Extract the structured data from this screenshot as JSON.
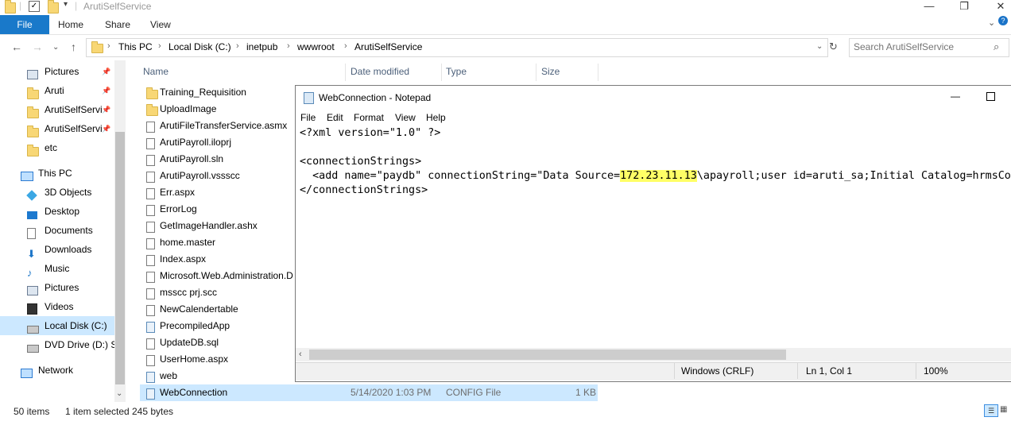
{
  "window": {
    "title": "ArutiSelfService",
    "minimize_glyph": "—",
    "restore_glyph": "❐",
    "close_glyph": "✕"
  },
  "ribbon": {
    "tabs": [
      "File",
      "Home",
      "Share",
      "View"
    ]
  },
  "address": {
    "crumbs": [
      "This PC",
      "Local Disk (C:)",
      "inetpub",
      "wwwroot",
      "ArutiSelfService"
    ]
  },
  "search": {
    "placeholder": "Search ArutiSelfService"
  },
  "sidebar": {
    "items": [
      {
        "label": "Pictures",
        "icon": "pictures-icon",
        "pinned": true
      },
      {
        "label": "Aruti",
        "icon": "folder-icon",
        "pinned": true
      },
      {
        "label": "ArutiSelfServi",
        "icon": "folder-icon",
        "pinned": true
      },
      {
        "label": "ArutiSelfServi",
        "icon": "folder-icon",
        "pinned": true
      },
      {
        "label": "etc",
        "icon": "folder-icon",
        "pinned": false
      },
      {
        "label": "This PC",
        "icon": "this-pc-icon",
        "pinned": false
      },
      {
        "label": "3D Objects",
        "icon": "3d-objects-icon",
        "pinned": false
      },
      {
        "label": "Desktop",
        "icon": "desktop-icon",
        "pinned": false
      },
      {
        "label": "Documents",
        "icon": "documents-icon",
        "pinned": false
      },
      {
        "label": "Downloads",
        "icon": "downloads-icon",
        "pinned": false
      },
      {
        "label": "Music",
        "icon": "music-icon",
        "pinned": false
      },
      {
        "label": "Pictures",
        "icon": "pictures-icon",
        "pinned": false
      },
      {
        "label": "Videos",
        "icon": "videos-icon",
        "pinned": false
      },
      {
        "label": "Local Disk (C:)",
        "icon": "local-disk-icon",
        "pinned": false
      },
      {
        "label": "DVD Drive (D:) SS",
        "icon": "dvd-drive-icon",
        "pinned": false
      },
      {
        "label": "Network",
        "icon": "network-icon",
        "pinned": false
      }
    ]
  },
  "file_list": {
    "columns": [
      "Name",
      "Date modified",
      "Type",
      "Size"
    ],
    "rows": [
      {
        "name": "Training_Requisition",
        "kind": "folder"
      },
      {
        "name": "UploadImage",
        "kind": "folder"
      },
      {
        "name": "ArutiFileTransferService.asmx",
        "kind": "file"
      },
      {
        "name": "ArutiPayroll.iloprj",
        "kind": "file"
      },
      {
        "name": "ArutiPayroll.sln",
        "kind": "file"
      },
      {
        "name": "ArutiPayroll.vssscc",
        "kind": "file"
      },
      {
        "name": "Err.aspx",
        "kind": "file"
      },
      {
        "name": "ErrorLog",
        "kind": "file"
      },
      {
        "name": "GetImageHandler.ashx",
        "kind": "file"
      },
      {
        "name": "home.master",
        "kind": "file"
      },
      {
        "name": "Index.aspx",
        "kind": "file"
      },
      {
        "name": "Microsoft.Web.Administration.D",
        "kind": "file"
      },
      {
        "name": "msscc prj.scc",
        "kind": "file"
      },
      {
        "name": "NewCalendertable",
        "kind": "file"
      },
      {
        "name": "PrecompiledApp",
        "kind": "config"
      },
      {
        "name": "UpdateDB.sql",
        "kind": "file"
      },
      {
        "name": "UserHome.aspx",
        "kind": "file"
      },
      {
        "name": "web",
        "kind": "config"
      },
      {
        "name": "WebConnection",
        "kind": "config",
        "date": "5/14/2020 1:03 PM",
        "type": "CONFIG File",
        "size": "1 KB",
        "selected": true
      }
    ]
  },
  "notepad": {
    "title": "WebConnection - Notepad",
    "menu": [
      "File",
      "Edit",
      "Format",
      "View",
      "Help"
    ],
    "lines": [
      "<?xml version=\"1.0\" ?>",
      "",
      "<connectionStrings>",
      "  <add name=\"paydb\" connectionString=\"Data Source=",
      "</connectionStrings>"
    ],
    "highlight": "172.23.11.13",
    "line4_rest": "\\apayroll;user id=aruti_sa;Initial Catalog=hrmsCon",
    "status": {
      "eol": "Windows (CRLF)",
      "position": "Ln 1, Col 1",
      "zoom": "100%"
    }
  },
  "statusbar": {
    "item_count": "50 items",
    "selection": "1 item selected",
    "size": "245 bytes"
  }
}
